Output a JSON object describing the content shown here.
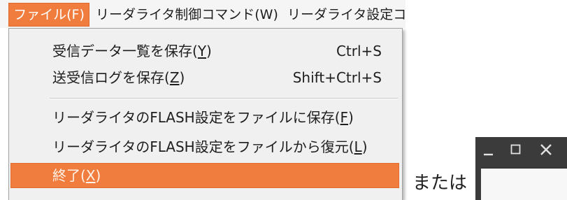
{
  "menubar": {
    "items": [
      {
        "label": "ファイル(F)",
        "active": true
      },
      {
        "label": "リーダライタ制御コマンド(W)"
      },
      {
        "label": "リーダライタ設定コ"
      }
    ]
  },
  "file_menu": {
    "items": [
      {
        "label": "受信データ一覧を保存(Y)",
        "shortcut": "Ctrl+S"
      },
      {
        "label": "送受信ログを保存(Z)",
        "shortcut": "Shift+Ctrl+S"
      },
      {
        "label": "リーダライタのFLASH設定をファイルに保存(F)"
      },
      {
        "label": "リーダライタのFLASH設定をファイルから復元(L)"
      },
      {
        "label": "終了(X)",
        "highlighted": true
      }
    ]
  },
  "connector_text": "または",
  "window_controls": {
    "icons": [
      "minimize-icon",
      "maximize-icon",
      "close-icon"
    ]
  },
  "colors": {
    "highlight": "#f07d3e",
    "menu_background": "#f0f0f0",
    "window_frame": "#3b3b3b"
  }
}
